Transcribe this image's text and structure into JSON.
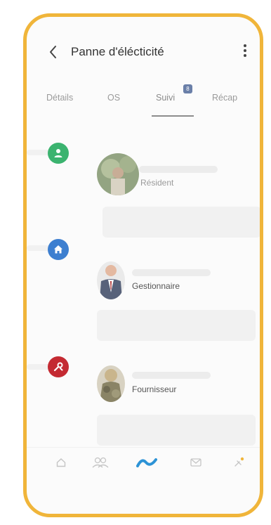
{
  "header": {
    "title": "Panne d'élécticité"
  },
  "tabs": [
    {
      "label": "Détails"
    },
    {
      "label": "OS"
    },
    {
      "label": "Suivi",
      "badge": "8"
    },
    {
      "label": "Récap"
    }
  ],
  "active_tab": "Suivi",
  "timeline": [
    {
      "role": "Résident",
      "icon": "user-icon",
      "color": "#3bb36f"
    },
    {
      "role": "Gestionnaire",
      "icon": "home-icon",
      "color": "#3d7fd0"
    },
    {
      "role": "Fournisseur",
      "icon": "wrench-icon",
      "color": "#c42a32"
    }
  ],
  "bottom_nav": [
    {
      "icon": "home-outline-icon"
    },
    {
      "icon": "users-icon"
    },
    {
      "icon": "activity-icon"
    },
    {
      "icon": "mail-icon"
    },
    {
      "icon": "notification-icon"
    }
  ],
  "colors": {
    "frame": "#f0b53a",
    "accent": "#2d93d6",
    "text": "#333333"
  }
}
